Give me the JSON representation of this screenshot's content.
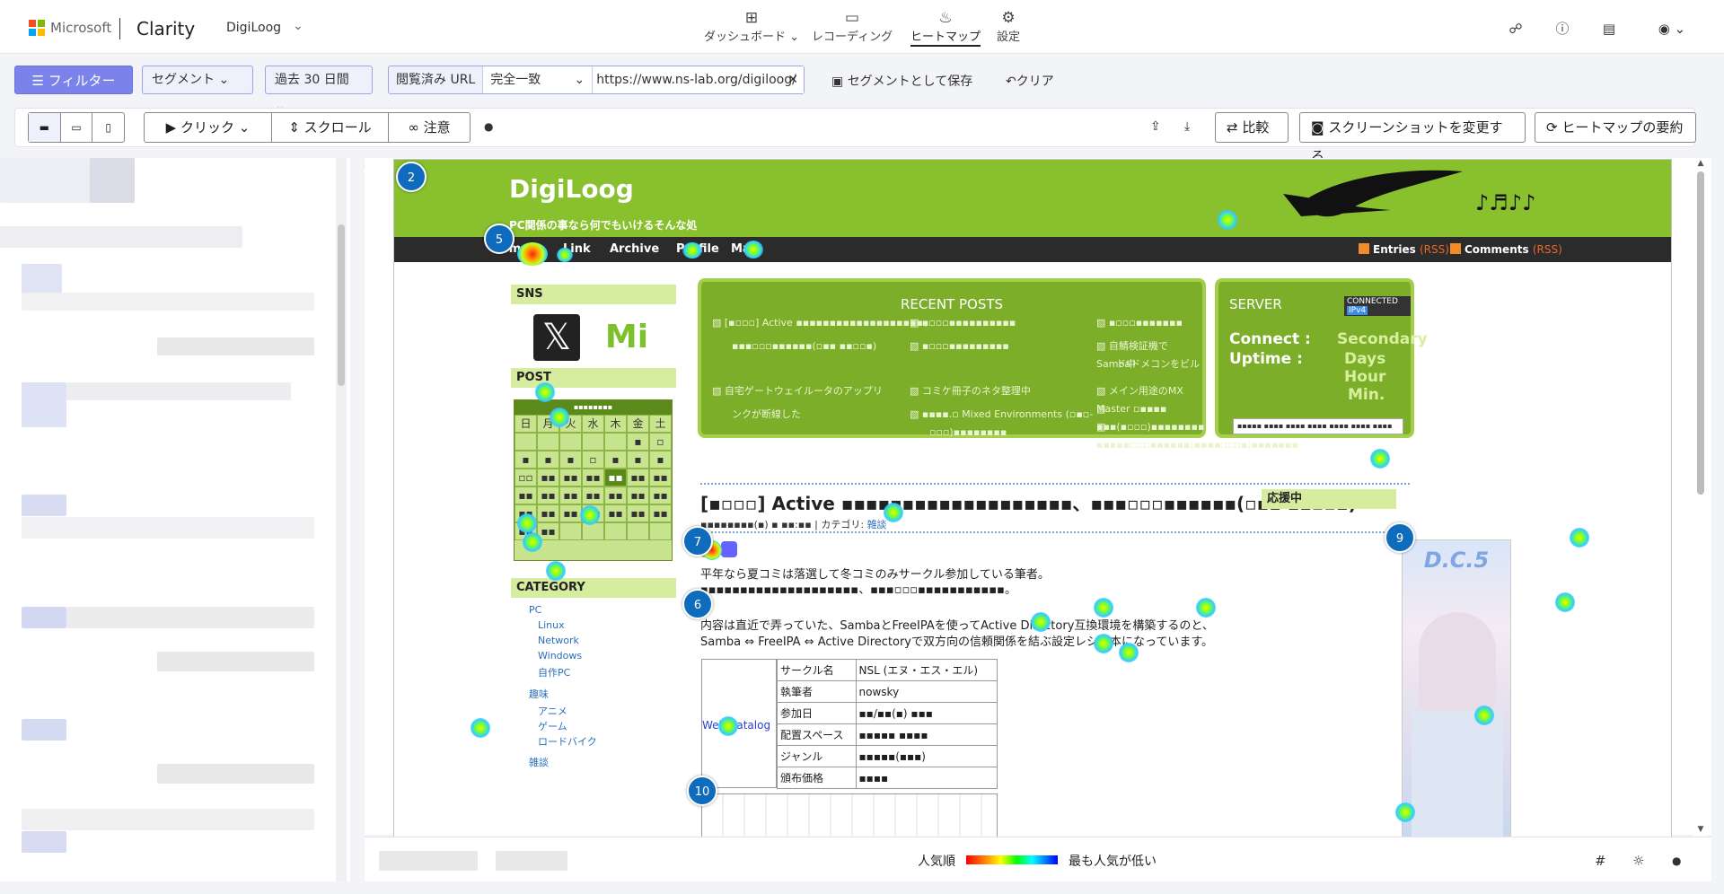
{
  "app": {
    "brand": "Microsoft",
    "product": "Clarity",
    "project": "DigiLoog"
  },
  "nav": {
    "dashboard": "ダッシュボード",
    "recordings": "レコーディング",
    "heatmaps": "ヒートマップ",
    "settings": "設定"
  },
  "filters": {
    "filter_btn": "フィルター",
    "segment_btn": "セグメント",
    "date_range": "過去 30 日間",
    "url_label": "閲覧済み URL",
    "match_type": "完全一致",
    "url_value": "https://www.ns-lab.org/digiloog/",
    "save_segment": "セグメントとして保存",
    "clear": "クリア"
  },
  "toolbar": {
    "click": "クリック",
    "scroll": "スクロール",
    "attention": "注意",
    "compare": "比較",
    "change_screenshot": "スクリーンショットを変更する",
    "summary": "ヒートマップの要約"
  },
  "page": {
    "row_zero": "0",
    "site_title": "DigiLoog",
    "site_subtitle": "PC関係の事なら何でもいけるそんな処",
    "nav": [
      "Home",
      "Link",
      "Archive",
      "Profile",
      "Mail"
    ],
    "rss_entries": "Entries",
    "rss_comments": "Comments",
    "rss_tag": "(RSS)",
    "sidebar": {
      "sns": "SNS",
      "post": "POST",
      "category": "CATEGORY",
      "weekdays": [
        "日",
        "月",
        "火",
        "水",
        "木",
        "金",
        "土"
      ],
      "categories": [
        "PC",
        "Linux",
        "Network",
        "Windows",
        "自作PC",
        "趣味",
        "アニメ",
        "ゲーム",
        "ロードバイク",
        "雑談"
      ]
    },
    "recent_posts": {
      "title": "RECENT POSTS",
      "items": [
        "[▪▫▫▫] Active ▪▪▪▪▪▪▪▪▪▪▪▪▪▪▪▪▪▪▪、",
        "▪▪▪▫▫▫▪▪▪▪▪▪(▫▪▪ ▪▪▫▫▪)",
        "自宅ゲートウェイルータのアップリ",
        "ンクが断線した",
        "▪▫▫▫▪▪▪▪▪▪▪▪▪▪",
        "▪▫▫▫▪▪▪▪▪▪▪▪▪",
        "コミケ冊子のネタ整理中",
        "▪▪▪▪.▫ Mixed Environments (▫▪▫-",
        "▫▫▫)▪▪▪▪▪▪▪▪",
        "▪▫▫▫▪▪▪▪▪▪▪",
        "自鯖検証機でSambaドメコンをビル",
        "ド中",
        "メイン用途のMX Master ▫▪▪▪▪",
        "▪▪▪(▪▫▫▫)▪▪▪▪▪▪▪▪",
        "▪▪▪▪▪▫▫▫▪▪▪▪▪▪(▪▪▪▪▫▫▫▪)▪▪▪▪▪▪▪"
      ]
    },
    "server": {
      "title": "SERVER",
      "badge": "CONNECTED",
      "badge2": "IPv4",
      "connect": "Connect :",
      "uptime": "Uptime :",
      "secondary": "Secondary",
      "days": "Days",
      "hour": "Hour",
      "min": "Min.",
      "input": "▪▪▪▪▪ ▪▪▪▪ ▪▪▪▪ ▪▪▪▪ ▪▪▪▪ ▪▪▪▪ ▪▪▪▪"
    },
    "article": {
      "title": "[▪▫▫▫] Active ▪▪▪▪▪▪▪▪▪▪▪▪▪▪▪▪▪▪▪、▪▪▪▫▫▫▪▪▪▪▪▪(▫▪▪ ▪▪▫▫▪)",
      "meta_pre": "▪▪▪▪▪▪▪▪(▪) ▪ ▪▪:▪▪ | カテゴリ: ",
      "meta_cat": "雑談",
      "p1": "平年なら夏コミは落選して冬コミのみサークル参加している筆者。",
      "p2": "▪▪▪▪▪▪▪▪▪▪▪▪▪▪▪▪▪▪▪▪、▪▪▪▫▫▫▪▪▪▪▪▪▪▪▪▪▪。",
      "p3": "内容は直近で弄っていた、SambaとFreeIPAを使ってActive Directory互換環境を構築するのと、",
      "p4": "Samba ⇔ FreeIPA ⇔ Active Directoryで双方向の信頼関係を結ぶ設定レシピ本になっています。",
      "web_catalog": "Web Catalog",
      "table": [
        [
          "サークル名",
          "NSL (エヌ・エス・エル)"
        ],
        [
          "執筆者",
          "nowsky"
        ],
        [
          "参加日",
          "▪▪/▪▪(▪) ▪▪▪"
        ],
        [
          "配置スペース",
          "▪▪▪▪▪ ▪▪▪▪"
        ],
        [
          "ジャンル",
          "▪▪▪▪▪(▪▪▪)"
        ],
        [
          "頒布価格",
          "▪▪▪▪"
        ]
      ]
    },
    "ouen": "応援中",
    "banner_text": "D.C.5",
    "markers": [
      "2",
      "5",
      "7",
      "6",
      "10",
      "9"
    ]
  },
  "legend": {
    "popular": "人気順",
    "least_popular": "最も人気が低い"
  },
  "colors": {
    "accent": "#7b83eb",
    "site_green": "#88c02e",
    "marker_blue": "#0f6cbd"
  }
}
